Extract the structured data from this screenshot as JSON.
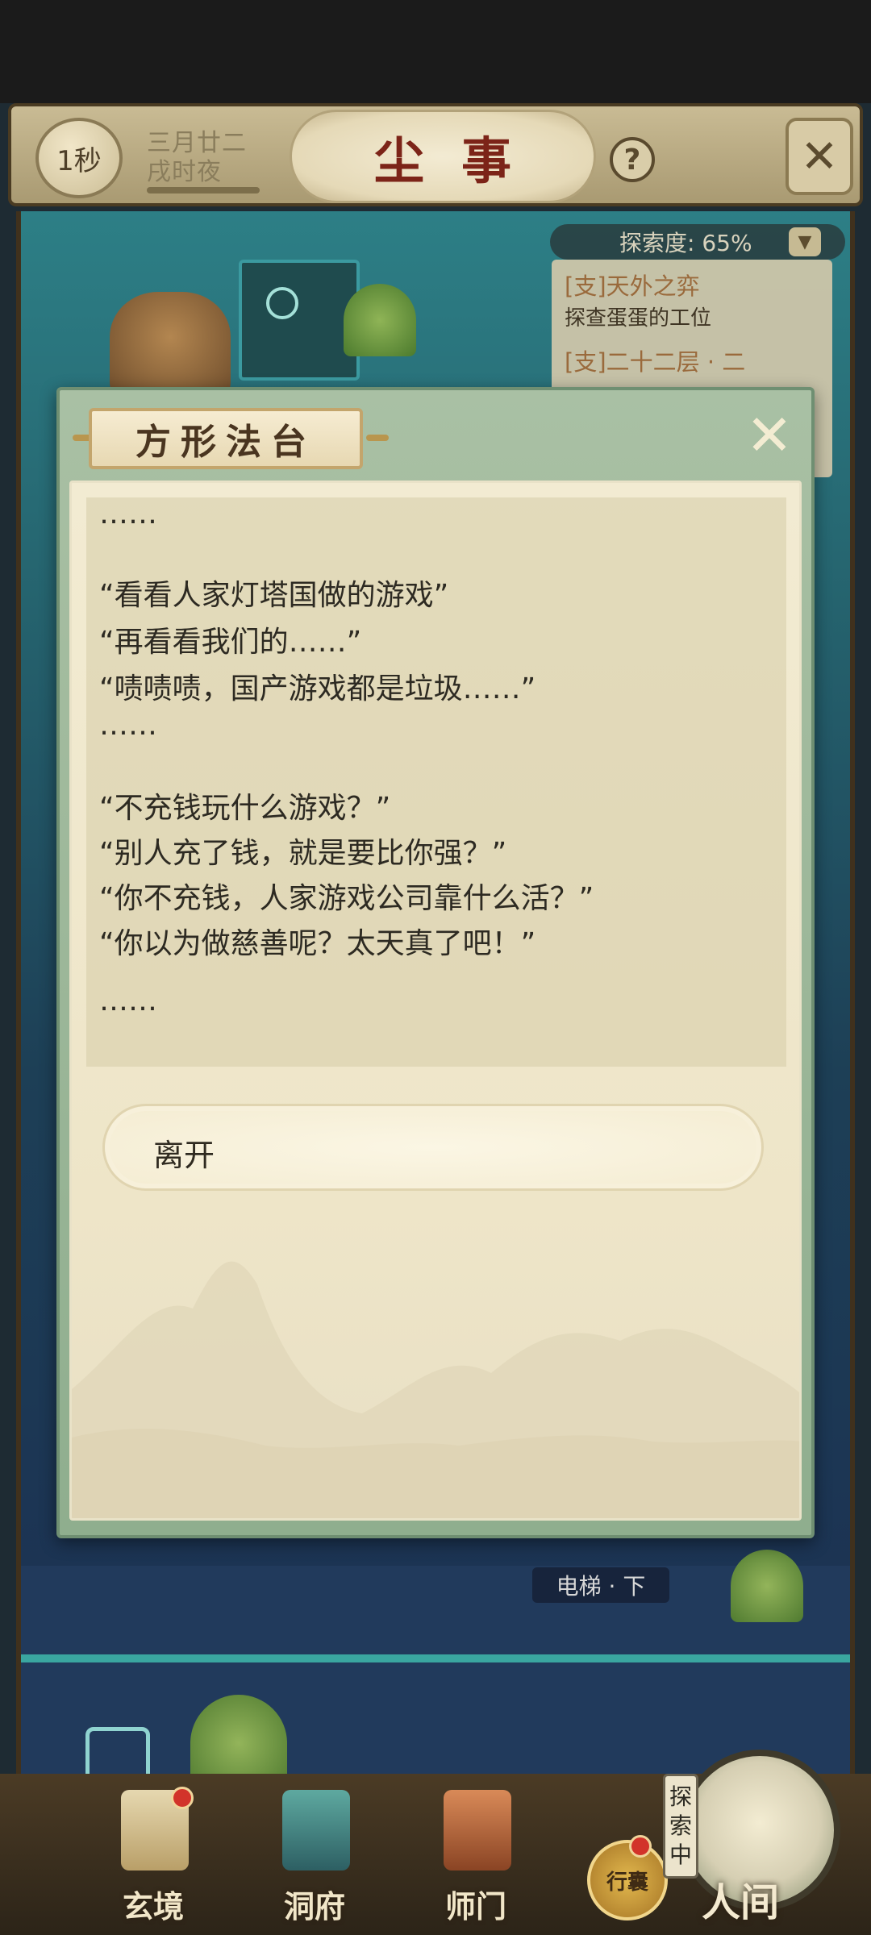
{
  "header": {
    "timer": "1秒",
    "date_line1": "三月廿二",
    "date_line2": "戌时夜",
    "title": "尘事",
    "help_icon": "?",
    "close_icon": "close-icon"
  },
  "explore": {
    "label": "探索度: 65%",
    "progress_percent": 65,
    "chevron_icon": "chevron-down-icon",
    "quests": [
      {
        "title": "[支]天外之弈",
        "subtitle": "探查蛋蛋的工位"
      },
      {
        "title": "[支]二十二层 · 二"
      }
    ]
  },
  "scene": {
    "elevator_label": "电梯 · 下"
  },
  "dialog": {
    "title": "方形法台",
    "close_icon": "close-icon",
    "lines": [
      "……",
      "",
      "“看看人家灯塔国做的游戏”",
      "“再看看我们的……”",
      "“啧啧啧，国产游戏都是垃圾……”",
      "……",
      "",
      "“不充钱玩什么游戏？”",
      "“别人充了钱，就是要比你强？”",
      "“你不充钱，人家游戏公司靠什么活？”",
      "“你以为做慈善呢？太天真了吧！”",
      "",
      "……"
    ],
    "option_leave": "离开"
  },
  "bottom_nav": {
    "items": [
      {
        "label": "玄境",
        "icon": "scroll-icon",
        "badge": true
      },
      {
        "label": "洞府",
        "icon": "pavilion-icon",
        "badge": false
      },
      {
        "label": "师门",
        "icon": "banner-icon",
        "badge": false
      }
    ],
    "bag_label": "行囊",
    "bag_badge": true,
    "exploring_tag": "探索中",
    "renjian_label": "人间"
  },
  "colors": {
    "title_red": "#7c2418",
    "dialog_frame": "#8fae8e",
    "parchment": "#f2ebd2",
    "badge_red": "#d2332a"
  }
}
